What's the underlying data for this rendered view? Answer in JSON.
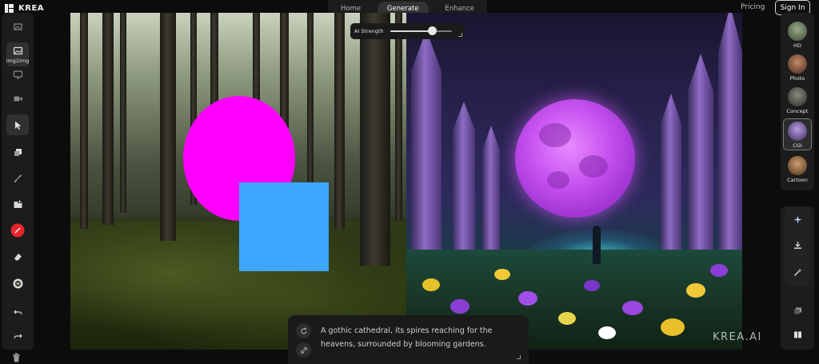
{
  "brand": {
    "name": "KREA"
  },
  "top_tabs": [
    {
      "label": "Home",
      "active": false
    },
    {
      "label": "Generate",
      "active": true
    },
    {
      "label": "Enhance",
      "active": false
    }
  ],
  "header": {
    "pricing": "Pricing",
    "signin": "Sign In"
  },
  "left_tools": [
    {
      "name": "img2img",
      "label": "img2img",
      "icon": "image-icon",
      "active": false
    }
  ],
  "ai_strength": {
    "label": "AI Strength",
    "value": 0.68
  },
  "prompt": {
    "text": "A gothic cathedral, its spires reaching for the heavens, surrounded by blooming gardens.",
    "buttons": [
      "refresh-icon",
      "link-icon"
    ]
  },
  "styles": [
    {
      "label": "HD",
      "active": false,
      "color": "#5a6a4a"
    },
    {
      "label": "Photo",
      "active": false,
      "color": "#8a5a3c"
    },
    {
      "label": "Concept",
      "active": false,
      "color": "#4a4a4a"
    },
    {
      "label": "CGI",
      "active": true,
      "color": "#7a5aa8"
    },
    {
      "label": "Cartoon",
      "active": false,
      "color": "#9a6a40"
    }
  ],
  "watermark": "KREA.AI",
  "colors": {
    "shape_circle": "#ff00ff",
    "shape_square": "#3ea6ff",
    "accent_red": "#e8262d"
  }
}
